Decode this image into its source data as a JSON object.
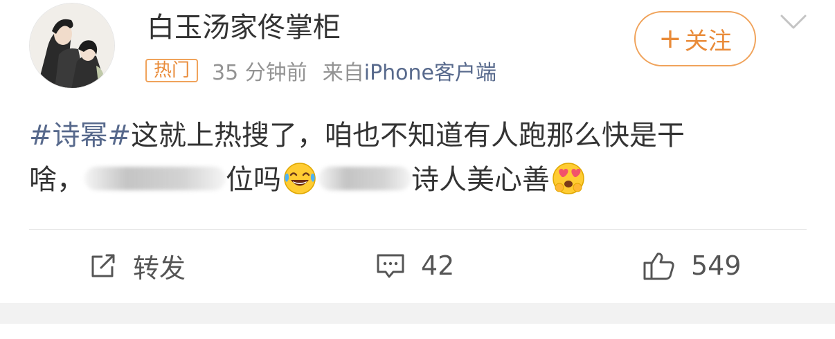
{
  "user": {
    "name": "白玉汤家佟掌柜",
    "avatar": "avatar-illustration"
  },
  "meta": {
    "badge": "热门",
    "time": "35 分钟前",
    "source_prefix": "来自",
    "source": "iPhone客户端"
  },
  "follow_button": {
    "plus": "+",
    "label": "关注"
  },
  "chevron_icon": "chevron-down-icon",
  "post": {
    "topic": "#诗幂#",
    "line1": "这就上热搜了，咱也不知道有人跑那么快是干",
    "line2_start": "啥，",
    "after_blur1": "位吗",
    "emoji1": "laughing-tears-emoji",
    "after_blur2": "诗人美心善",
    "emoji2": "heart-eyes-emoji"
  },
  "actions": {
    "repost_label": "转发",
    "repost_icon": "share-icon",
    "comment_count": "42",
    "comment_icon": "comment-icon",
    "like_count": "549",
    "like_icon": "thumbs-up-icon"
  },
  "colors": {
    "accent_orange": "#e98b39",
    "link_blue": "#57698c",
    "text_dark": "#333333",
    "text_gray": "#939393"
  }
}
